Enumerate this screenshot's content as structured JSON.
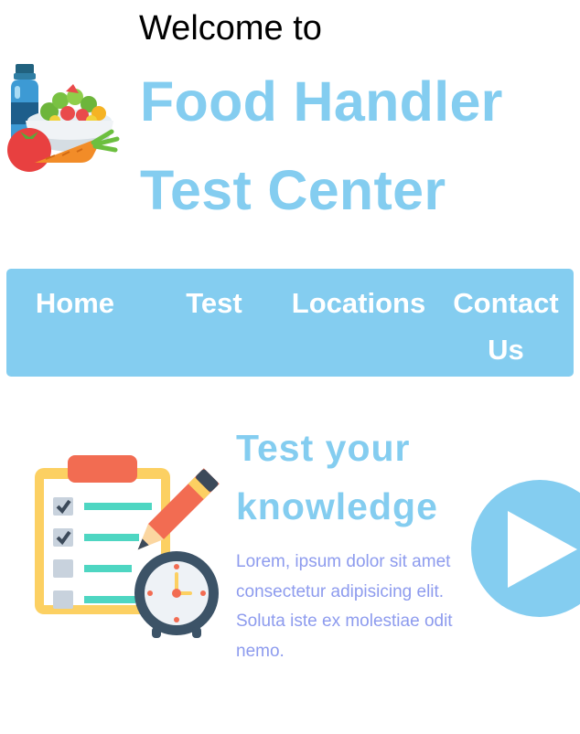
{
  "header": {
    "welcome": "Welcome to",
    "title_line1": "Food Handler",
    "title_line2": "Test Center",
    "logo_icon": "food-basket-icon"
  },
  "nav": {
    "items": [
      {
        "label": "Home"
      },
      {
        "label": "Test"
      },
      {
        "label": "Locations"
      },
      {
        "label": "Contact Us"
      }
    ]
  },
  "feature": {
    "title": "Test your knowledge",
    "body": "Lorem, ipsum dolor sit amet consectetur adipisicing elit. Soluta iste ex molestiae odit nemo.",
    "illustration_icon": "checklist-clock-icon",
    "play_icon": "play-icon"
  },
  "colors": {
    "accent": "#84cdf0",
    "body_text": "#8d9bee",
    "nav_text": "#ffffff"
  }
}
